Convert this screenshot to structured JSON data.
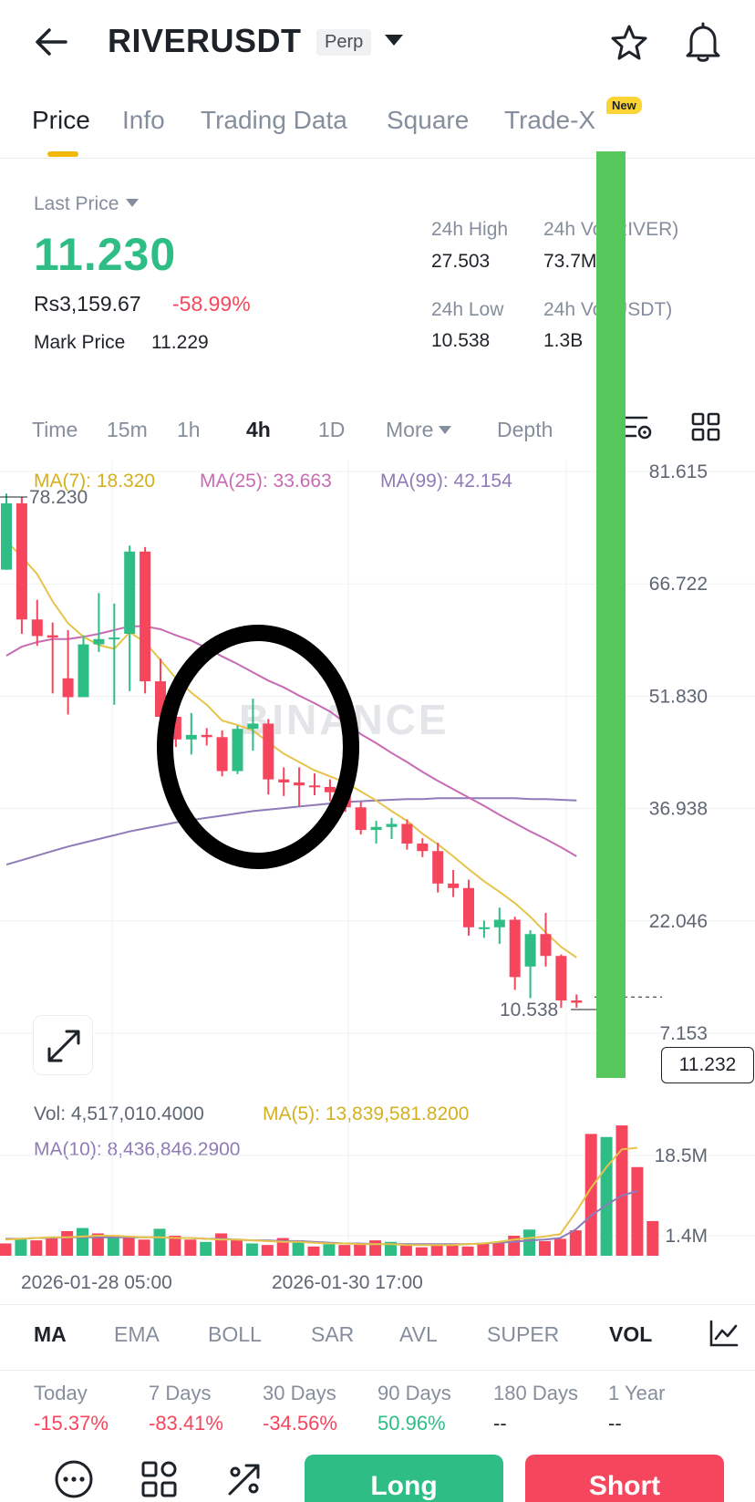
{
  "header": {
    "symbol": "RIVERUSDT",
    "contract_type": "Perp",
    "icons": [
      "back-arrow-icon",
      "caret-down-icon",
      "star-icon",
      "bell-icon"
    ]
  },
  "tabs": [
    {
      "label": "Price",
      "active": true
    },
    {
      "label": "Info"
    },
    {
      "label": "Trading Data"
    },
    {
      "label": "Square"
    },
    {
      "label": "Trade-X",
      "badge": "New"
    }
  ],
  "price": {
    "last_price_label": "Last Price",
    "last_price": "11.230",
    "fiat_price": "Rs3,159.67",
    "change_pct": "-58.99%",
    "mark_price_label": "Mark Price",
    "mark_price": "11.229"
  },
  "stats": {
    "high_label": "24h High",
    "high_value": "27.503",
    "low_label": "24h Low",
    "low_value": "10.538",
    "vol_river_label": "24h Vol(RIVER)",
    "vol_river_value": "73.7M",
    "vol_usdt_label": "24h Vol(USDT)",
    "vol_usdt_value": "1.3B"
  },
  "timeframes": [
    {
      "label": "Time"
    },
    {
      "label": "15m"
    },
    {
      "label": "1h"
    },
    {
      "label": "4h",
      "active": true
    },
    {
      "label": "1D"
    },
    {
      "label": "More"
    },
    {
      "label": "Depth"
    }
  ],
  "ma_legend": {
    "ma7": "MA(7): 18.320",
    "ma25": "MA(25): 33.663",
    "ma99": "MA(99): 42.154",
    "colors": {
      "ma7": "#e6c34a",
      "ma25": "#c86bb4",
      "ma99": "#8f7bb8"
    }
  },
  "colors": {
    "up": "#2ebd85",
    "down": "#f6465d",
    "overlay_green": "#55c75d",
    "circle": "#000000"
  },
  "chart_data": {
    "type": "candlestick",
    "watermark": "BINANCE",
    "y_ticks": [
      "81.615",
      "66.722",
      "51.830",
      "36.938",
      "22.046",
      "7.153"
    ],
    "ylim": [
      7.153,
      81.615
    ],
    "high_marker": "78.230",
    "low_marker": "10.538",
    "current_price_tag": "11.232",
    "candles": [
      {
        "o": 68.6,
        "h": 78.7,
        "l": 68.6,
        "c": 77.4
      },
      {
        "o": 77.4,
        "h": 78.2,
        "l": 60.1,
        "c": 62.0
      },
      {
        "o": 62.0,
        "h": 64.6,
        "l": 58.5,
        "c": 59.8
      },
      {
        "o": 59.9,
        "h": 61.6,
        "l": 52.2,
        "c": 59.6
      },
      {
        "o": 54.2,
        "h": 60.6,
        "l": 49.4,
        "c": 51.7
      },
      {
        "o": 51.7,
        "h": 59.9,
        "l": 51.7,
        "c": 58.7
      },
      {
        "o": 58.7,
        "h": 65.5,
        "l": 57.7,
        "c": 59.4
      },
      {
        "o": 59.4,
        "h": 64.1,
        "l": 50.7,
        "c": 59.6
      },
      {
        "o": 60.1,
        "h": 71.8,
        "l": 52.5,
        "c": 71.0
      },
      {
        "o": 71.0,
        "h": 71.6,
        "l": 52.2,
        "c": 53.8
      },
      {
        "o": 53.8,
        "h": 56.8,
        "l": 47.1,
        "c": 49.1
      },
      {
        "o": 49.1,
        "h": 50.3,
        "l": 45.1,
        "c": 46.1
      },
      {
        "o": 46.1,
        "h": 49.6,
        "l": 44.1,
        "c": 46.7
      },
      {
        "o": 46.7,
        "h": 47.6,
        "l": 45.3,
        "c": 46.4
      },
      {
        "o": 46.4,
        "h": 47.3,
        "l": 41.2,
        "c": 41.9
      },
      {
        "o": 41.9,
        "h": 47.9,
        "l": 41.5,
        "c": 47.5
      },
      {
        "o": 47.5,
        "h": 51.5,
        "l": 44.6,
        "c": 48.2
      },
      {
        "o": 48.2,
        "h": 48.8,
        "l": 38.8,
        "c": 40.8
      },
      {
        "o": 40.8,
        "h": 42.4,
        "l": 38.6,
        "c": 40.4
      },
      {
        "o": 40.4,
        "h": 42.4,
        "l": 37.3,
        "c": 40.0
      },
      {
        "o": 40.0,
        "h": 41.6,
        "l": 38.7,
        "c": 39.8
      },
      {
        "o": 39.8,
        "h": 40.8,
        "l": 37.9,
        "c": 39.1
      },
      {
        "o": 39.1,
        "h": 40.1,
        "l": 36.5,
        "c": 37.1
      },
      {
        "o": 37.1,
        "h": 37.8,
        "l": 33.5,
        "c": 34.1
      },
      {
        "o": 34.1,
        "h": 35.3,
        "l": 32.3,
        "c": 34.5
      },
      {
        "o": 34.5,
        "h": 35.7,
        "l": 32.9,
        "c": 34.9
      },
      {
        "o": 34.9,
        "h": 35.5,
        "l": 31.5,
        "c": 32.3
      },
      {
        "o": 32.3,
        "h": 33.0,
        "l": 30.5,
        "c": 31.3
      },
      {
        "o": 31.3,
        "h": 32.4,
        "l": 25.8,
        "c": 27.0
      },
      {
        "o": 27.0,
        "h": 28.8,
        "l": 25.2,
        "c": 26.4
      },
      {
        "o": 26.4,
        "h": 27.5,
        "l": 20.1,
        "c": 21.2
      },
      {
        "o": 21.2,
        "h": 22.1,
        "l": 19.8,
        "c": 21.2
      },
      {
        "o": 21.2,
        "h": 23.8,
        "l": 19.0,
        "c": 22.2
      },
      {
        "o": 22.2,
        "h": 22.6,
        "l": 12.9,
        "c": 14.6
      },
      {
        "o": 16.0,
        "h": 20.8,
        "l": 11.8,
        "c": 20.3
      },
      {
        "o": 20.3,
        "h": 23.1,
        "l": 16.0,
        "c": 17.4
      },
      {
        "o": 17.4,
        "h": 17.6,
        "l": 10.5,
        "c": 11.5
      },
      {
        "o": 11.5,
        "h": 12.3,
        "l": 10.538,
        "c": 11.2
      }
    ],
    "ma7": [
      72.4,
      70.3,
      68.0,
      64.4,
      61.5,
      59.7,
      58.6,
      58.1,
      60.3,
      59.0,
      56.6,
      54.2,
      52.3,
      50.7,
      48.6,
      48.0,
      47.3,
      45.7,
      44.2,
      43.1,
      42.0,
      41.2,
      40.4,
      39.2,
      38.0,
      36.6,
      35.3,
      33.6,
      32.2,
      30.6,
      28.9,
      27.3,
      25.9,
      24.4,
      22.6,
      20.5,
      18.6,
      17.2
    ],
    "ma25": [
      57.2,
      58.4,
      59.0,
      59.4,
      59.4,
      59.7,
      60.1,
      60.6,
      61.1,
      61.1,
      60.7,
      59.9,
      59.2,
      58.2,
      57.1,
      56.1,
      55.0,
      53.9,
      53.0,
      51.9,
      50.9,
      49.8,
      48.3,
      46.8,
      45.6,
      44.3,
      43.1,
      41.8,
      40.6,
      39.5,
      38.4,
      37.3,
      36.1,
      35.0,
      33.9,
      32.9,
      31.8,
      30.6
    ],
    "ma99": [
      29.5,
      30.1,
      30.7,
      31.3,
      31.9,
      32.4,
      32.9,
      33.4,
      33.9,
      34.3,
      34.7,
      35.1,
      35.4,
      35.7,
      36.0,
      36.3,
      36.6,
      36.8,
      37.0,
      37.2,
      37.4,
      37.6,
      37.8,
      37.9,
      38.0,
      38.1,
      38.2,
      38.2,
      38.3,
      38.3,
      38.3,
      38.3,
      38.3,
      38.3,
      38.2,
      38.2,
      38.1,
      38.0
    ]
  },
  "volume": {
    "vol_label": "Vol: 4,517,010.4000",
    "ma5_label": "MA(5): 13,839,581.8200",
    "ma10_label": "MA(10): 8,436,846.2900",
    "y_ticks": [
      "18.5M",
      "1.4M"
    ],
    "bars_m": [
      1.6,
      2.2,
      2.0,
      2.3,
      3.2,
      3.6,
      2.9,
      2.3,
      2.5,
      2.1,
      3.5,
      2.6,
      2.1,
      1.8,
      2.9,
      2.2,
      1.6,
      1.4,
      2.3,
      2.0,
      1.2,
      1.5,
      1.4,
      1.6,
      2.0,
      1.8,
      1.3,
      1.1,
      1.4,
      1.3,
      1.2,
      1.6,
      1.8,
      2.6,
      3.4,
      1.9,
      2.2,
      3.3,
      15.8,
      15.4,
      16.9,
      11.5,
      4.5
    ],
    "ma5_m": [
      2.1,
      2.2,
      2.3,
      2.4,
      2.4,
      2.5,
      2.6,
      2.6,
      2.5,
      2.4,
      2.4,
      2.3,
      2.3,
      2.2,
      2.1,
      2.1,
      2.0,
      1.9,
      1.8,
      1.8,
      1.7,
      1.6,
      1.6,
      1.5,
      1.5,
      1.5,
      1.4,
      1.4,
      1.4,
      1.4,
      1.5,
      1.6,
      1.8,
      2.1,
      2.3,
      2.5,
      2.8,
      5.6,
      8.8,
      11.5,
      13.8,
      14.0
    ],
    "ma10_m": [
      2.2,
      2.2,
      2.3,
      2.3,
      2.4,
      2.4,
      2.4,
      2.4,
      2.4,
      2.4,
      2.4,
      2.3,
      2.3,
      2.2,
      2.2,
      2.1,
      2.0,
      2.0,
      1.9,
      1.9,
      1.8,
      1.7,
      1.6,
      1.6,
      1.5,
      1.5,
      1.5,
      1.5,
      1.5,
      1.5,
      1.5,
      1.6,
      1.7,
      1.8,
      2.0,
      2.1,
      2.3,
      3.4,
      5.2,
      6.6,
      7.8,
      8.4
    ]
  },
  "dates": [
    "2026-01-28 05:00",
    "2026-01-30 17:00"
  ],
  "indicators": [
    {
      "label": "MA",
      "active": true
    },
    {
      "label": "EMA"
    },
    {
      "label": "BOLL"
    },
    {
      "label": "SAR"
    },
    {
      "label": "AVL"
    },
    {
      "label": "SUPER"
    },
    {
      "label": "VOL",
      "active": true
    }
  ],
  "performance": [
    {
      "label": "Today",
      "value": "-15.37%",
      "dir": "down"
    },
    {
      "label": "7 Days",
      "value": "-83.41%",
      "dir": "down"
    },
    {
      "label": "30 Days",
      "value": "-34.56%",
      "dir": "down"
    },
    {
      "label": "90 Days",
      "value": "50.96%",
      "dir": "up"
    },
    {
      "label": "180 Days",
      "value": "--",
      "dir": "none"
    },
    {
      "label": "1 Year",
      "value": "--",
      "dir": "none"
    }
  ],
  "actions": {
    "long_label": "Long",
    "short_label": "Short"
  }
}
